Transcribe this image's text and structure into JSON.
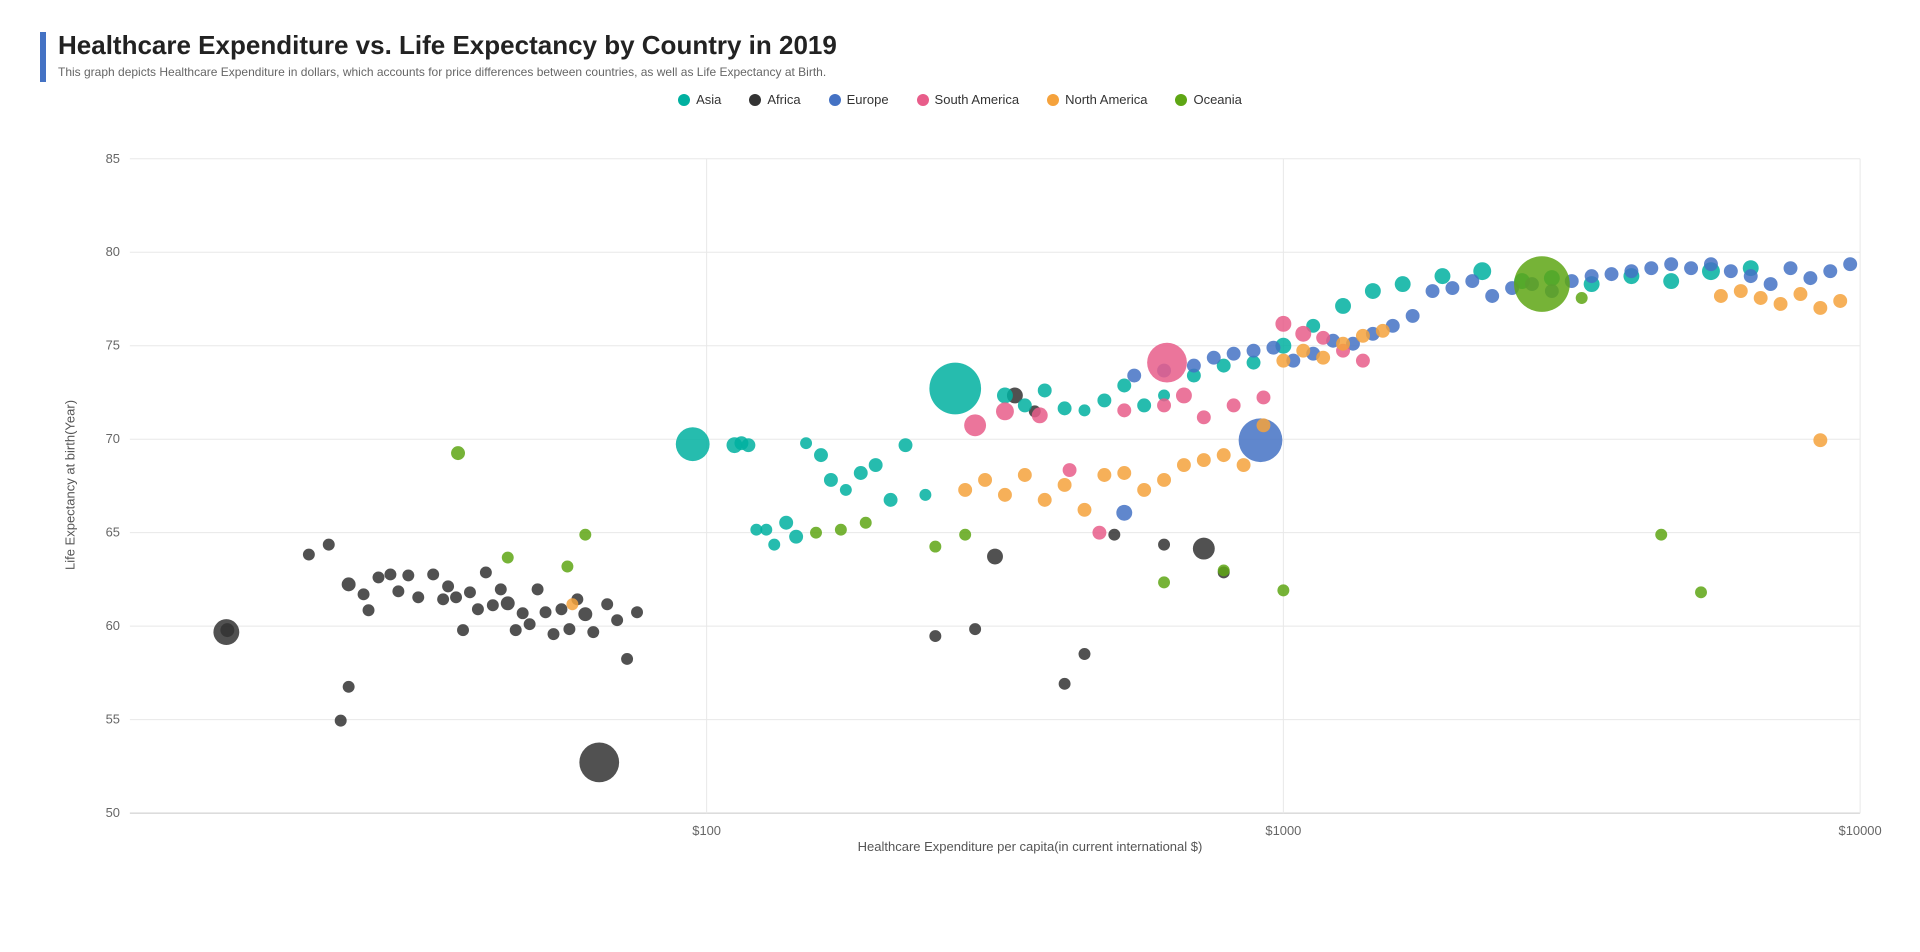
{
  "title": "Healthcare Expenditure vs. Life Expectancy by Country in 2019",
  "subtitle": "This graph depicts Healthcare Expenditure in dollars, which accounts for price differences between countries, as well as Life Expectancy at Birth.",
  "legend": [
    {
      "label": "Asia",
      "color": "#00b0a0"
    },
    {
      "label": "Africa",
      "color": "#333333"
    },
    {
      "label": "Europe",
      "color": "#4472c4"
    },
    {
      "label": "South America",
      "color": "#e85d8a"
    },
    {
      "label": "North America",
      "color": "#f5a23c"
    },
    {
      "label": "Oceania",
      "color": "#5ea614"
    }
  ],
  "yAxis": {
    "label": "Life Expectancy at birth(Year)",
    "ticks": [
      50,
      55,
      60,
      65,
      70,
      75,
      80,
      85
    ]
  },
  "xAxis": {
    "label": "Healthcare Expenditure per capita(in current international $)",
    "ticks": [
      "$100",
      "$1000",
      "$10000"
    ]
  }
}
